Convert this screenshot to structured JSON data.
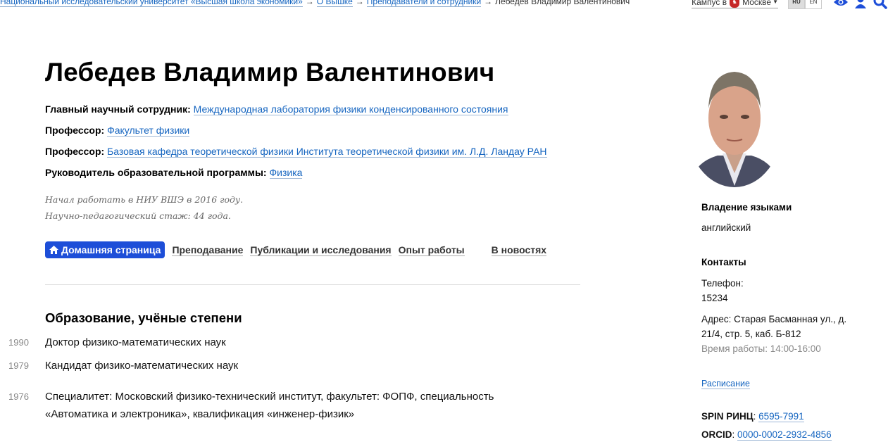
{
  "breadcrumb": {
    "items": [
      "Национальный исследовательский университет «Высшая школа экономики»",
      "О Вышке",
      "Преподаватели и сотрудники"
    ],
    "current": "Лебедев Владимир Валентинович",
    "separator": "→"
  },
  "topbar": {
    "campus_label": "Кампус в",
    "campus_city": "Москве",
    "lang_ru": "RU",
    "lang_en": "EN"
  },
  "profile": {
    "name": "Лебедев Владимир Валентинович",
    "positions": [
      {
        "role": "Главный научный сотрудник:",
        "unit": "Международная лаборатория физики конденсированного состояния"
      },
      {
        "role": "Профессор:",
        "unit": "Факультет физики"
      },
      {
        "role": "Профессор:",
        "unit": "Базовая кафедра теоретической физики Института теоретической физики им. Л.Д. Ландау РАН"
      },
      {
        "role": "Руководитель образовательной программы:",
        "unit": "Физика"
      }
    ],
    "started": "Начал работать в НИУ ВШЭ в 2016 году.",
    "experience": "Научно-педагогический стаж: 44 года."
  },
  "tabs": {
    "home": "Домашняя страница",
    "teaching": "Преподавание",
    "publications": "Публикации и исследования",
    "experience": "Опыт работы",
    "news": "В новостях"
  },
  "education": {
    "title": "Образование, учёные степени",
    "items": [
      {
        "year": "1990",
        "text": "Доктор физико-математических наук"
      },
      {
        "year": "1979",
        "text": "Кандидат физико-математических наук"
      },
      {
        "year": "1976",
        "text": "Специалитет: Московский физико-технический институт, факультет: ФОПФ, специальность «Автоматика и электроника», квалификация «инженер-физик»"
      }
    ]
  },
  "sidebar": {
    "languages_title": "Владение языками",
    "languages_value": "английский",
    "contacts_title": "Контакты",
    "phone_label": "Телефон:",
    "phone_value": "15234",
    "address_line1": "Адрес: Старая Басманная ул., д.",
    "address_line2": "21/4, стр. 5, каб. Б-812",
    "hours": "Время работы: 14:00-16:00",
    "schedule_link": "Расписание",
    "spin_label": "SPIN РИНЦ",
    "spin_value": "6595-7991",
    "orcid_label": "ORCID",
    "orcid_value": "0000-0002-2932-4856"
  },
  "colors": {
    "link": "#1565c0",
    "tab_active_bg": "#1d4ed8",
    "campus_crest": "#c62828"
  }
}
